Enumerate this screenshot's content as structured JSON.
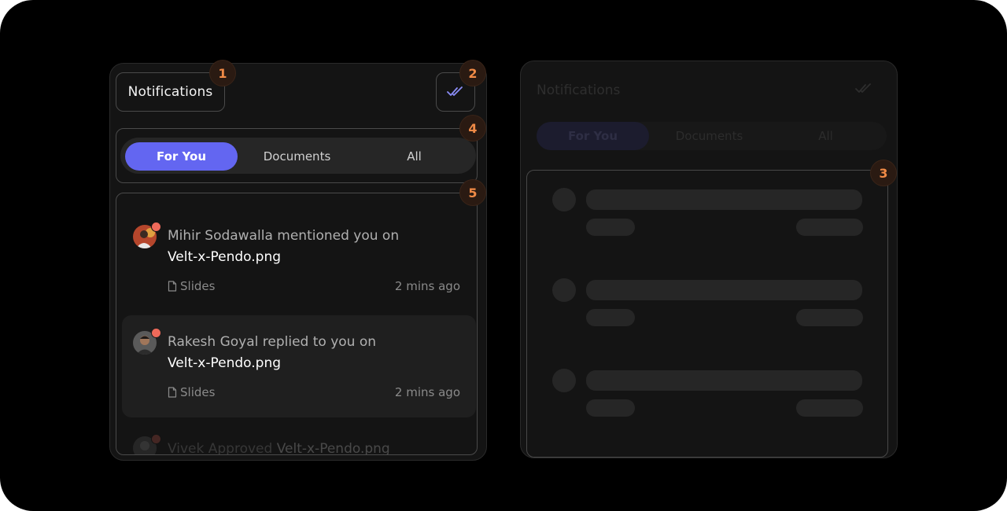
{
  "left_panel": {
    "title": "Notifications",
    "mark_all_icon": "double-check-icon",
    "tabs": [
      {
        "label": "For You",
        "active": true
      },
      {
        "label": "Documents",
        "active": false
      },
      {
        "label": "All",
        "active": false
      }
    ],
    "notifications": [
      {
        "actor_action": "Mihir Sodawalla mentioned you on",
        "file": "Velt-x-Pendo.png",
        "source": "Slides",
        "source_icon": "document-icon",
        "time": "2 mins ago",
        "unread": true
      },
      {
        "actor_action": "Rakesh Goyal replied to you on",
        "file": "Velt-x-Pendo.png",
        "source": "Slides",
        "source_icon": "document-icon",
        "time": "2 mins ago",
        "unread": true,
        "highlighted": true
      }
    ],
    "faded_notification": {
      "actor_action": "Vivek Approved",
      "file": "Velt-x-Pendo.png"
    }
  },
  "right_panel": {
    "title": "Notifications",
    "tabs": [
      "For You",
      "Documents",
      "All"
    ],
    "skeleton_rows": 3
  },
  "badges": [
    "1",
    "2",
    "3",
    "4",
    "5"
  ],
  "colors": {
    "accent": "#6366f1",
    "badge_text": "#f08a46",
    "unread_dot": "#ef6a5a",
    "panel_bg": "#141414"
  }
}
